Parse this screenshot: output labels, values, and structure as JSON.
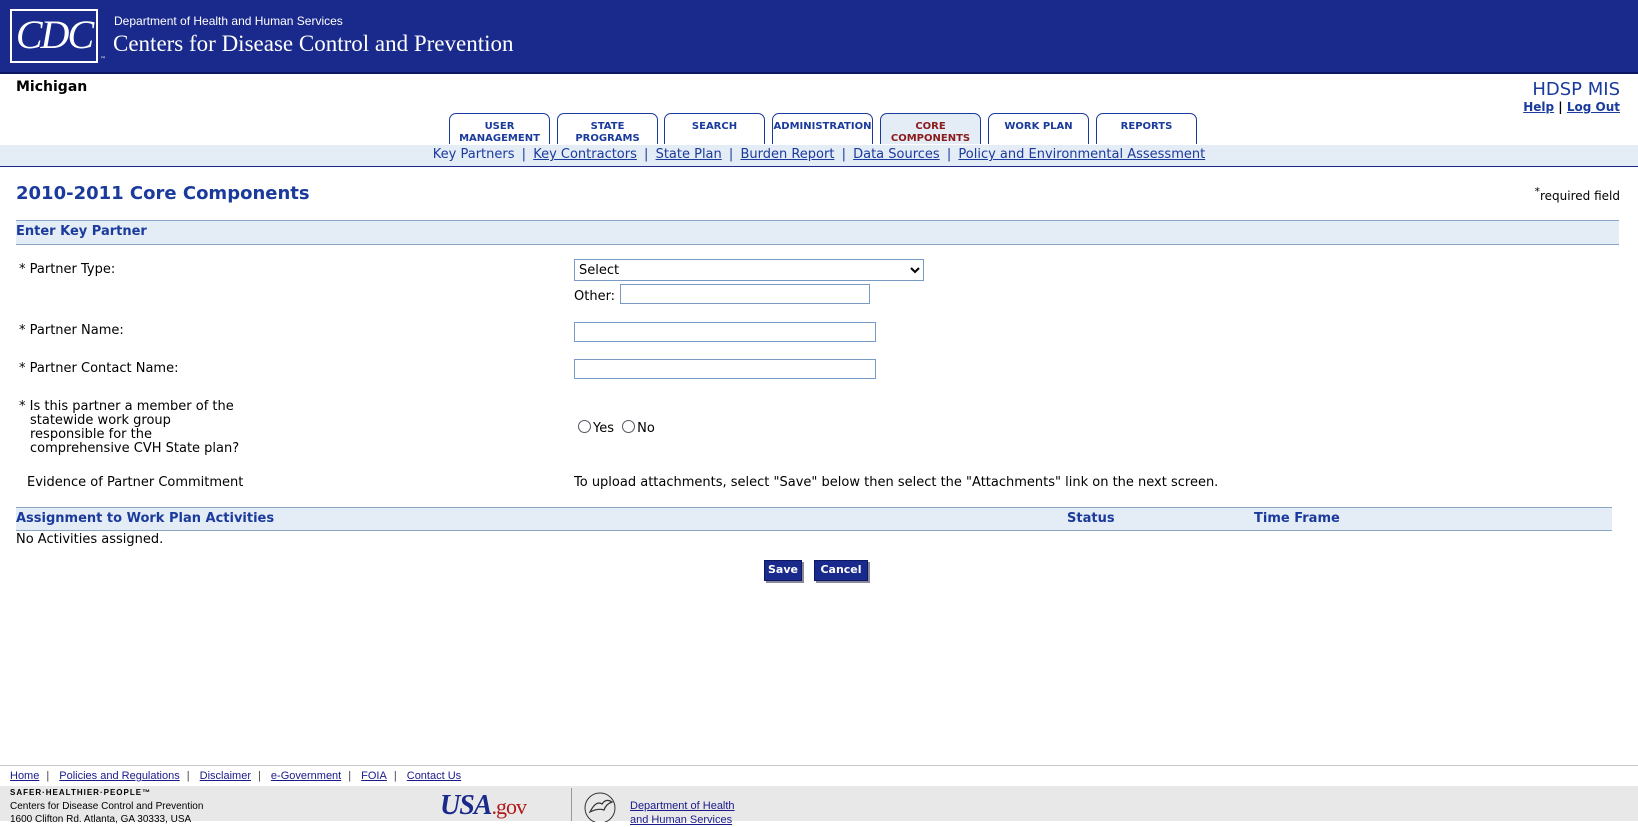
{
  "header": {
    "logo_text": "CDC",
    "department": "Department of Health and Human Services",
    "agency": "Centers for Disease Control and Prevention",
    "state": "Michigan",
    "app_name": "HDSP MIS",
    "help_link": "Help",
    "separator": "|",
    "logout_link": "Log Out"
  },
  "tabs": [
    {
      "line1": "USER",
      "line2": "MANAGEMENT",
      "active": false
    },
    {
      "line1": "STATE",
      "line2": "PROGRAMS",
      "active": false
    },
    {
      "line1": "SEARCH",
      "line2": "",
      "active": false
    },
    {
      "line1": "ADMINISTRATION",
      "line2": "",
      "active": false
    },
    {
      "line1": "CORE",
      "line2": "COMPONENTS",
      "active": true
    },
    {
      "line1": "WORK PLAN",
      "line2": "",
      "active": false
    },
    {
      "line1": "REPORTS",
      "line2": "",
      "active": false
    }
  ],
  "subnav": {
    "current": "Key Partners",
    "links": [
      "Key Contractors",
      "State Plan",
      "Burden Report",
      "Data Sources",
      "Policy and Environmental Assessment"
    ],
    "separator": "|"
  },
  "page": {
    "title": "2010-2011 Core Components",
    "required_mark": "*",
    "required_text": "required field",
    "section_title": "Enter Key Partner"
  },
  "form": {
    "partner_type_label": "* Partner Type:",
    "partner_type_selected": "Select",
    "other_label": "Other:",
    "other_value": "",
    "partner_name_label": "* Partner Name:",
    "partner_name_value": "",
    "partner_contact_label": "* Partner Contact Name:",
    "partner_contact_value": "",
    "member_question_line1": "* Is this partner a member of the",
    "member_question_line2": "statewide work group",
    "member_question_line3": "responsible for the",
    "member_question_line4": "comprehensive CVH State plan?",
    "yes_label": "Yes",
    "no_label": "No",
    "evidence_label": "Evidence of Partner Commitment",
    "upload_note": "To upload attachments, select \"Save\" below then select the \"Attachments\" link on the next screen."
  },
  "assignments": {
    "title": "Assignment to Work Plan Activities",
    "status_header": "Status",
    "timeframe_header": "Time Frame",
    "empty_text": "No Activities assigned."
  },
  "buttons": {
    "save": "Save",
    "cancel": "Cancel"
  },
  "footer": {
    "links": [
      "Home",
      "Policies and Regulations",
      "Disclaimer",
      "e-Government",
      "FOIA",
      "Contact Us"
    ],
    "separator": "|",
    "tagline": "SAFER·HEALTHIER·PEOPLE™",
    "address_line1": "Centers for Disease Control and Prevention",
    "address_line2": "1600 Clifton Rd. Atlanta, GA 30333, USA",
    "usa_gov_main": "USA",
    "usa_gov_suffix": ".gov",
    "hhs_line1": "Department of Health",
    "hhs_line2": "and Human Services"
  },
  "colors": {
    "banner": "#1a2a8c",
    "accent": "#1a3a9c",
    "active_tab_text": "#8b1a1a",
    "section_bg": "#e4ecf6"
  }
}
